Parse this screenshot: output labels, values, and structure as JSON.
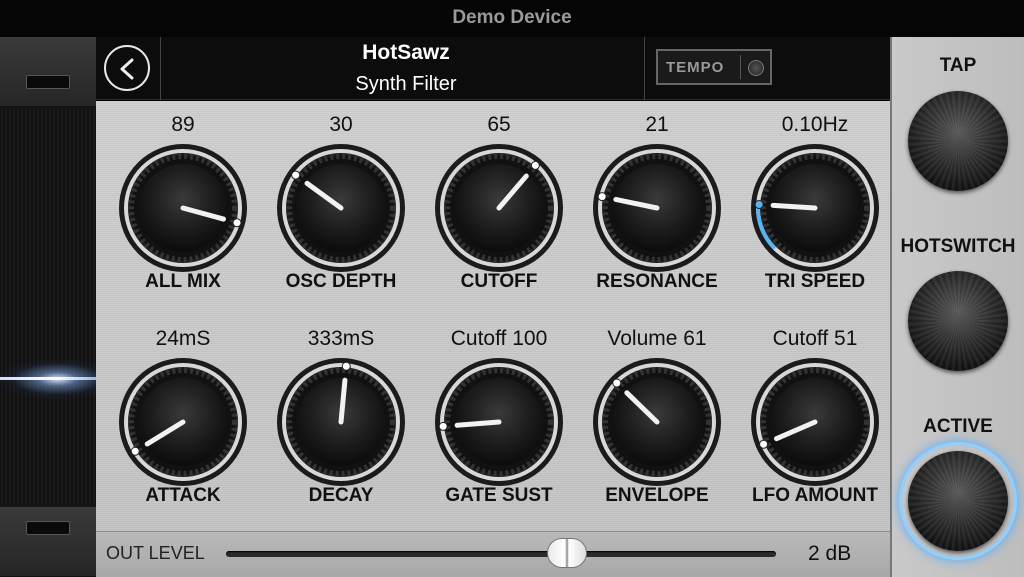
{
  "window": {
    "title": "Demo Device"
  },
  "header": {
    "preset_name": "HotSawz",
    "device_name": "Synth Filter",
    "tempo_label": "TEMPO"
  },
  "knobs_row1": [
    {
      "name": "ALL MIX",
      "value": "89",
      "level": 0.89
    },
    {
      "name": "OSC DEPTH",
      "value": "30",
      "level": 0.3
    },
    {
      "name": "CUTOFF",
      "value": "65",
      "level": 0.65
    },
    {
      "name": "RESONANCE",
      "value": "21",
      "level": 0.21
    },
    {
      "name": "TRI SPEED",
      "value": "0.10Hz",
      "level": 0.18
    }
  ],
  "knobs_row2": [
    {
      "name": "ATTACK",
      "value": "24mS",
      "level": 0.05
    },
    {
      "name": "DECAY",
      "value": "333mS",
      "level": 0.52
    },
    {
      "name": "GATE SUST",
      "value": "Cutoff 100",
      "level": 0.15
    },
    {
      "name": "ENVELOPE",
      "value": "Volume  61",
      "level": 0.33
    },
    {
      "name": "LFO AMOUNT",
      "value": "Cutoff  51",
      "level": 0.08
    }
  ],
  "out_level": {
    "label": "OUT LEVEL",
    "value": "2 dB",
    "level": 0.62
  },
  "sidebar": {
    "tap_label": "TAP",
    "hotswitch_label": "HOTSWITCH",
    "active_label": "ACTIVE"
  },
  "colors": {
    "accent": "#5ab4f0",
    "panel": "#c8c8c8",
    "knob": "#1a1a1a"
  }
}
